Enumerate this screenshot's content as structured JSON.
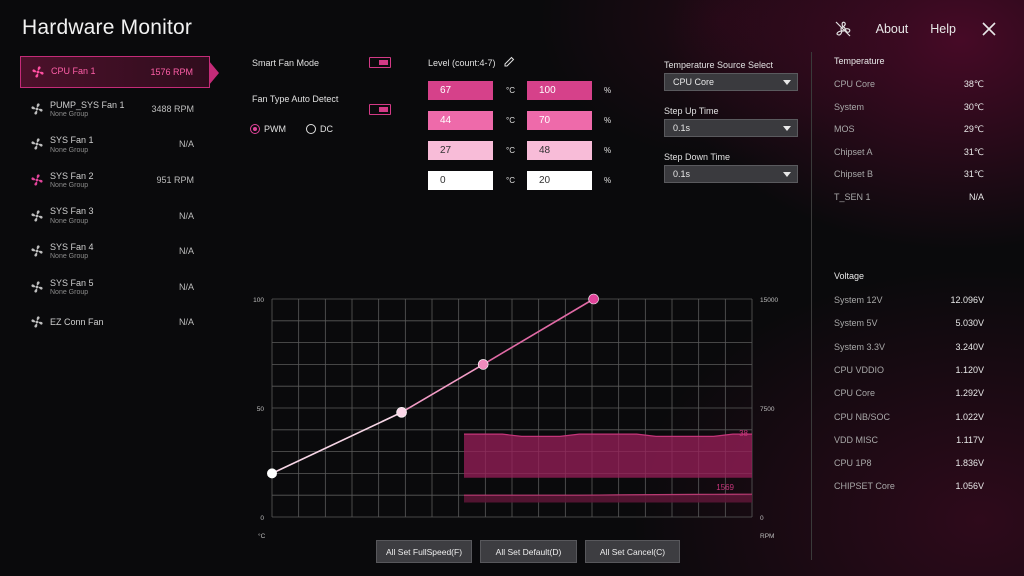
{
  "app": {
    "title": "Hardware Monitor"
  },
  "topbar": {
    "about": "About",
    "help": "Help",
    "icons": [
      "fan-off-icon",
      "close-icon"
    ]
  },
  "fans": [
    {
      "name": "CPU Fan 1",
      "group": "",
      "value": "1576 RPM",
      "active": true,
      "color": "#ff4fa0"
    },
    {
      "name": "PUMP_SYS Fan 1",
      "group": "None Group",
      "value": "3488 RPM",
      "active": false,
      "color": "#bdbdbd"
    },
    {
      "name": "SYS Fan 1",
      "group": "None Group",
      "value": "N/A",
      "active": false,
      "color": "#bdbdbd"
    },
    {
      "name": "SYS Fan 2",
      "group": "None Group",
      "value": "951 RPM",
      "active": false,
      "color": "#e0449a"
    },
    {
      "name": "SYS Fan 3",
      "group": "None Group",
      "value": "N/A",
      "active": false,
      "color": "#bdbdbd"
    },
    {
      "name": "SYS Fan 4",
      "group": "None Group",
      "value": "N/A",
      "active": false,
      "color": "#bdbdbd"
    },
    {
      "name": "SYS Fan 5",
      "group": "None Group",
      "value": "N/A",
      "active": false,
      "color": "#bdbdbd"
    },
    {
      "name": "EZ Conn Fan",
      "group": "",
      "value": "N/A",
      "active": false,
      "color": "#bdbdbd"
    }
  ],
  "controls": {
    "smart_fan_mode": "Smart Fan Mode",
    "fan_type_auto_detect": "Fan Type Auto Detect",
    "pwm": "PWM",
    "dc": "DC",
    "pwm_selected": true,
    "level_label": "Level (count:4-7)"
  },
  "levels": [
    {
      "temp": "67",
      "temp_unit": "°C",
      "speed": "100",
      "speed_unit": "%",
      "color": "#d6418a",
      "text": "#ffffff"
    },
    {
      "temp": "44",
      "temp_unit": "°C",
      "speed": "70",
      "speed_unit": "%",
      "color": "#ee6aaa",
      "text": "#ffffff"
    },
    {
      "temp": "27",
      "temp_unit": "°C",
      "speed": "48",
      "speed_unit": "%",
      "color": "#f8bcd8",
      "text": "#333333"
    },
    {
      "temp": "0",
      "temp_unit": "°C",
      "speed": "20",
      "speed_unit": "%",
      "color": "#ffffff",
      "text": "#333333"
    }
  ],
  "settings": {
    "temp_source_label": "Temperature Source Select",
    "temp_source_value": "CPU Core",
    "step_up_label": "Step Up Time",
    "step_up_value": "0.1s",
    "step_down_label": "Step Down Time",
    "step_down_value": "0.1s"
  },
  "temperature": {
    "title": "Temperature",
    "rows": [
      {
        "k": "CPU Core",
        "v": "38℃"
      },
      {
        "k": "System",
        "v": "30℃"
      },
      {
        "k": "MOS",
        "v": "29℃"
      },
      {
        "k": "Chipset A",
        "v": "31℃"
      },
      {
        "k": "Chipset B",
        "v": "31℃"
      },
      {
        "k": "T_SEN 1",
        "v": "N/A"
      }
    ]
  },
  "voltage": {
    "title": "Voltage",
    "rows": [
      {
        "k": "System 12V",
        "v": "12.096V"
      },
      {
        "k": "System 5V",
        "v": "5.030V"
      },
      {
        "k": "System 3.3V",
        "v": "3.240V"
      },
      {
        "k": "CPU VDDIO",
        "v": "1.120V"
      },
      {
        "k": "CPU Core",
        "v": "1.292V"
      },
      {
        "k": "CPU NB/SOC",
        "v": "1.022V"
      },
      {
        "k": "VDD MISC",
        "v": "1.117V"
      },
      {
        "k": "CPU 1P8",
        "v": "1.836V"
      },
      {
        "k": "CHIPSET Core",
        "v": "1.056V"
      }
    ]
  },
  "buttons": {
    "fullspeed": "All Set FullSpeed(F)",
    "default": "All Set Default(D)",
    "cancel": "All Set Cancel(C)"
  },
  "chart_data": {
    "type": "line",
    "left_ticks": [
      "100",
      "50",
      "0"
    ],
    "right_ticks": [
      "15000",
      "7500",
      "0"
    ],
    "x_unit": "°C",
    "right_unit": "RPM",
    "fan_curve": [
      {
        "x": 0,
        "y": 20
      },
      {
        "x": 27,
        "y": 48
      },
      {
        "x": 44,
        "y": 70
      },
      {
        "x": 67,
        "y": 100
      }
    ],
    "temp_history_value": "38",
    "rpm_history_value": "1569",
    "temp_history": [
      38,
      38,
      38,
      37,
      37,
      37,
      38,
      38,
      38,
      38,
      37,
      37,
      37,
      37,
      38,
      38
    ],
    "rpm_history": [
      1500,
      1500,
      1500,
      1500,
      1500,
      1500,
      1500,
      1510,
      1520,
      1530,
      1540,
      1550,
      1555,
      1560,
      1565,
      1569
    ],
    "xlim": [
      0,
      100
    ],
    "ylim": [
      0,
      100
    ],
    "rpm_lim": [
      0,
      15000
    ],
    "colors": {
      "curve": "#f4b0cf",
      "point_hi": "#e0449a",
      "band": "#9a1f5a",
      "grid": "#5a5a5a"
    }
  }
}
